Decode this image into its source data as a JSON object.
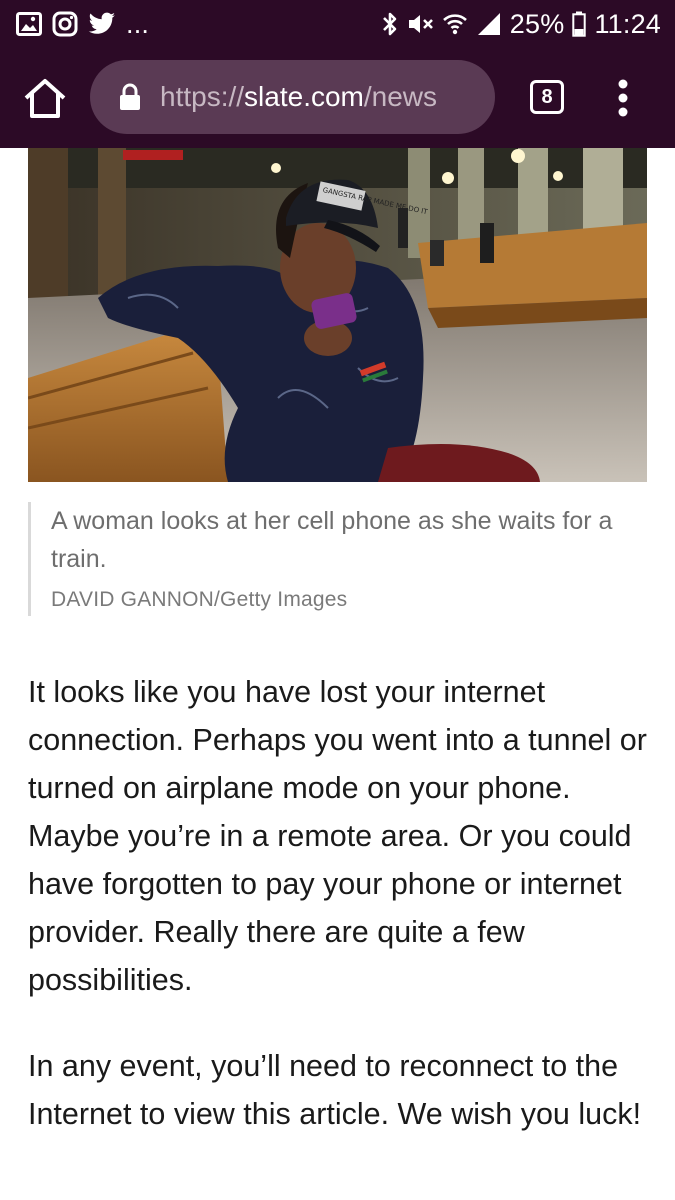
{
  "status_bar": {
    "notification_icons": [
      "gallery-icon",
      "instagram-icon",
      "twitter-icon"
    ],
    "overflow": "...",
    "battery": "25%",
    "time": "11:24",
    "system_icons": [
      "bluetooth-icon",
      "mute-icon",
      "wifi-icon",
      "signal-icon",
      "battery-icon"
    ]
  },
  "browser": {
    "url_scheme": "https://",
    "url_host": "slate.com",
    "url_path": "/news",
    "tab_count": "8"
  },
  "figure": {
    "image_alt": "A woman looks at her cell phone as she waits for a train.",
    "cap_text": "GANGSTA RAP MADE ME DO IT",
    "caption": "A woman looks at her cell phone as she waits for a train.",
    "credit": "DAVID GANNON/Getty Images"
  },
  "article": {
    "paragraphs": [
      "It looks like you have lost your internet connection. Perhaps you went into a tunnel or turned on airplane mode on your phone. Maybe you’re in a remote area. Or you could have forgotten to pay your phone or internet provider. Really there are quite a few possibilities.",
      "In any event, you’ll need to reconnect to the Internet to view this article. We wish you luck!"
    ]
  },
  "colors": {
    "toolbar": "#2c0a26",
    "url_pill": "#5a3a54",
    "caption_text": "#6e6e6e",
    "body_text": "#1a1a1a"
  }
}
